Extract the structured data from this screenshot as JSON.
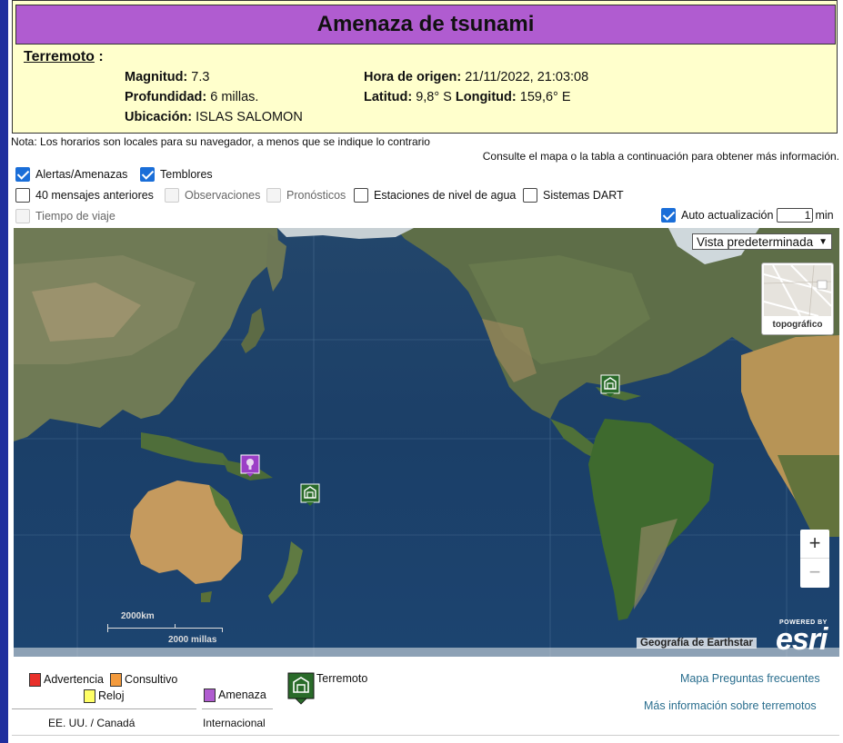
{
  "title": "Amenaza de tsunami",
  "event": {
    "label": "Terremoto",
    "label_suffix": " :",
    "magnitude_label": "Magnitud:",
    "magnitude": "7.3",
    "depth_label": "Profundidad:",
    "depth": "6 millas.",
    "location_label": "Ubicación:",
    "location": "ISLAS SALOMON",
    "origin_label": "Hora de origen:",
    "origin": "21/11/2022, 21:03:08",
    "lat_label": "Latitud:",
    "lat": "9,8° S",
    "lon_label": "Longitud:",
    "lon": "159,6° E"
  },
  "note": "Nota: Los horarios son locales para su navegador, a menos que se indique lo contrario",
  "consult": "Consulte el mapa o la tabla a continuación para obtener más información.",
  "options": {
    "alerts": {
      "label": "Alertas/Amenazas",
      "checked": true
    },
    "quakes": {
      "label": "Temblores",
      "checked": true
    },
    "prev_messages": {
      "label": "40 mensajes anteriores",
      "checked": false
    },
    "observations": {
      "label": "Observaciones",
      "checked": false,
      "disabled": true
    },
    "forecasts": {
      "label": "Pronósticos",
      "checked": false,
      "disabled": true
    },
    "water_stations": {
      "label": "Estaciones de nivel de agua",
      "checked": false
    },
    "dart": {
      "label": "Sistemas DART",
      "checked": false
    },
    "travel_time": {
      "label": "Tiempo de viaje",
      "checked": false,
      "disabled": true
    },
    "auto_refresh": {
      "label": "Auto actualización",
      "checked": true,
      "value": "1",
      "unit": "min"
    }
  },
  "map": {
    "view_select": "Vista predeterminada",
    "basemap_label": "topográfico",
    "zoom_in": "+",
    "zoom_out": "−",
    "scale_km": "2000km",
    "scale_mi": "2000 millas",
    "attribution": "Geografía de Earthstar",
    "powered_by": "POWERED BY",
    "esri": "esri",
    "markers": [
      {
        "type": "threat",
        "color": "#9b3fc6"
      },
      {
        "type": "earthquake",
        "color": "#2a6b2a"
      },
      {
        "type": "earthquake",
        "color": "#2a6b2a"
      }
    ]
  },
  "legend": {
    "warning": {
      "label": "Advertencia",
      "color": "#e8302a"
    },
    "advisory": {
      "label": "Consultivo",
      "color": "#f39a3c"
    },
    "watch": {
      "label": "Reloj",
      "color": "#ffff66"
    },
    "threat": {
      "label": "Amenaza",
      "color": "#b05cd0"
    },
    "earthquake": {
      "label": "Terremoto"
    },
    "us_canada": "EE. UU. / Canadá",
    "international": "Internacional",
    "faq_link": "Mapa Preguntas frecuentes",
    "more_link": "Más información sobre terremotos"
  }
}
